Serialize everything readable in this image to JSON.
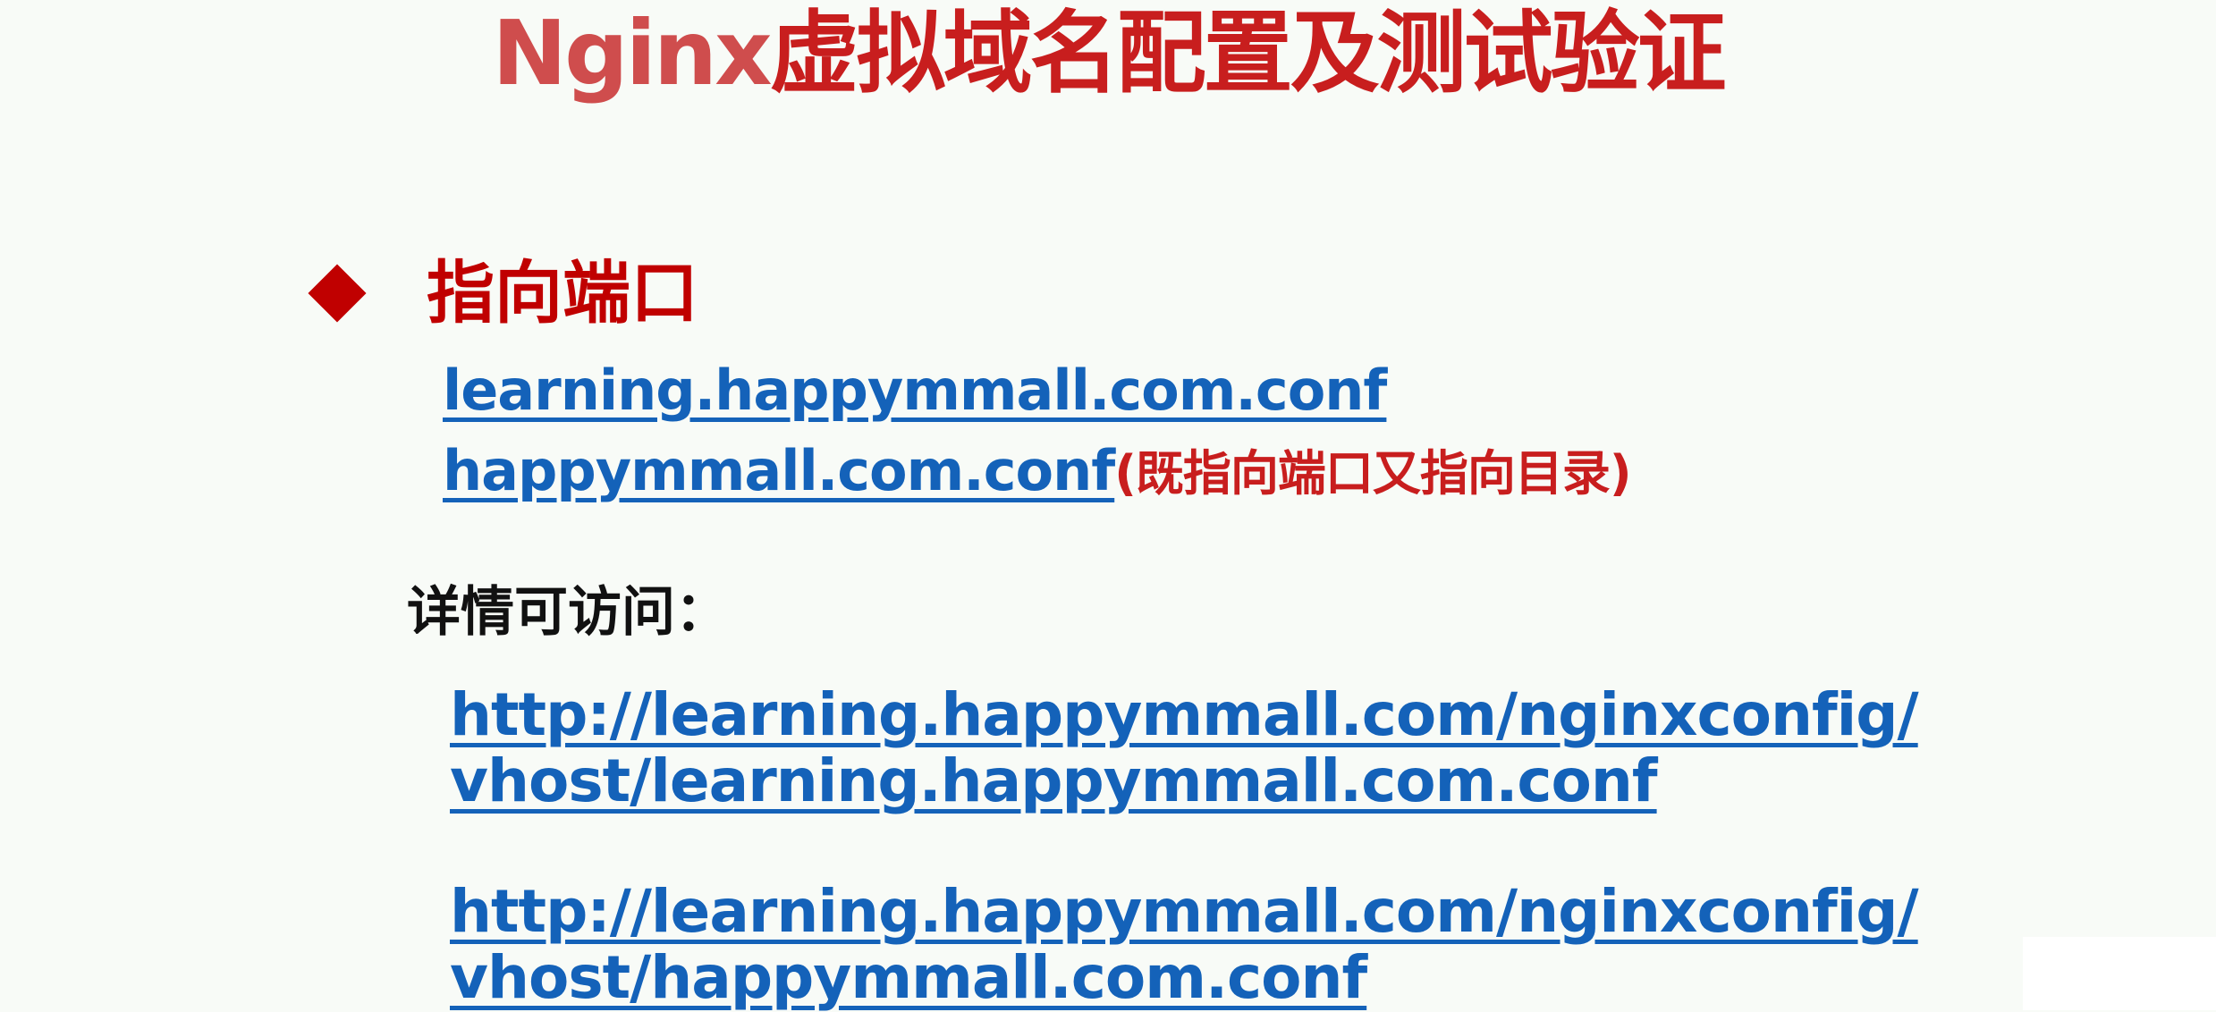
{
  "title": {
    "latin": "Nginx",
    "cjk": "虚拟域名配置及测试验证"
  },
  "section": {
    "heading": "指向端口"
  },
  "config_files": [
    {
      "name": "learning.happymmall.com.conf",
      "note": ""
    },
    {
      "name": "happymmall.com.conf",
      "note": "(既指向端口又指向目录)"
    }
  ],
  "details": {
    "label": "详情可访问：",
    "urls": [
      {
        "line1": "http://learning.happymmall.com/nginxconfig/",
        "line2": "vhost/learning.happymmall.com.conf"
      },
      {
        "line1": "http://learning.happymmall.com/nginxconfig/",
        "line2": "vhost/happymmall.com.conf"
      }
    ]
  },
  "colors": {
    "background": "#f8fbf7",
    "title_red": "#c81e1e",
    "heading_red": "#c00000",
    "link_blue": "#1462b9",
    "label_black": "#111111"
  }
}
